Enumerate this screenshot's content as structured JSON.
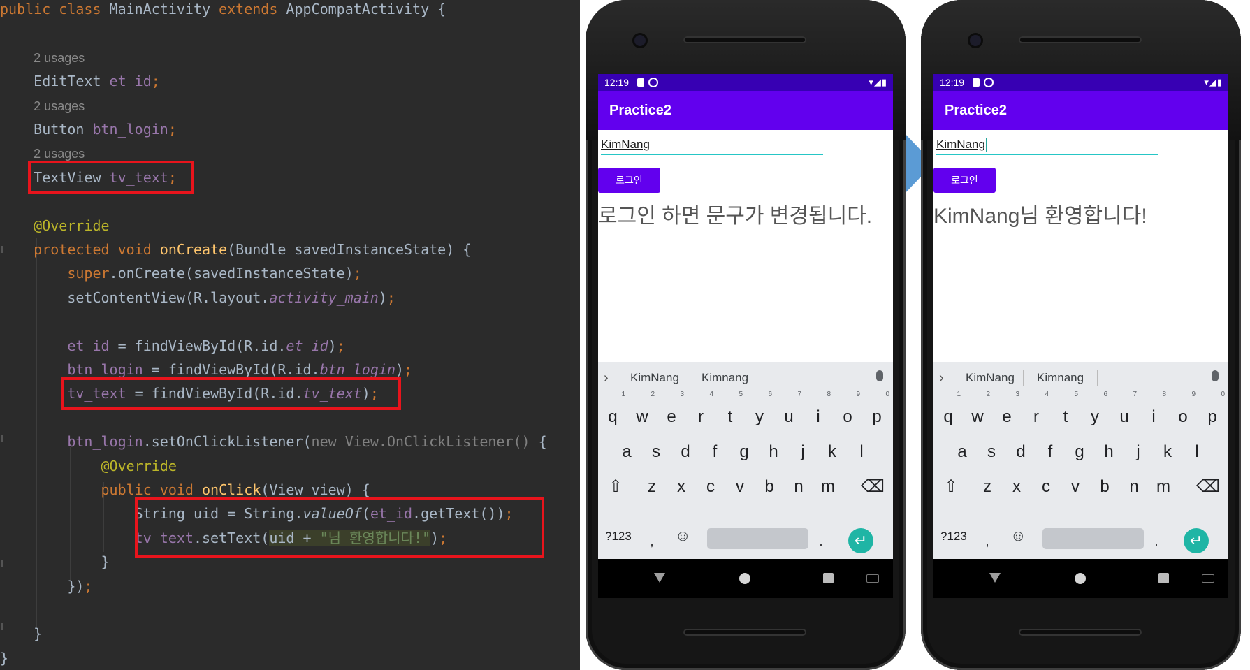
{
  "code_lines": [
    [
      {
        "t": "public",
        "c": "kw"
      },
      {
        "t": " "
      },
      {
        "t": "class",
        "c": "kw"
      },
      {
        "t": " MainActivity "
      },
      {
        "t": "extends",
        "c": "kw"
      },
      {
        "t": " AppCompatActivity {"
      }
    ],
    [],
    [
      {
        "t": "    "
      },
      {
        "t": "2 usages",
        "c": "usage"
      }
    ],
    [
      {
        "t": "    EditText "
      },
      {
        "t": "et_id",
        "c": "fld"
      },
      {
        "t": ";",
        "c": "kw"
      }
    ],
    [
      {
        "t": "    "
      },
      {
        "t": "2 usages",
        "c": "usage"
      }
    ],
    [
      {
        "t": "    Button "
      },
      {
        "t": "btn_login",
        "c": "fld"
      },
      {
        "t": ";",
        "c": "kw"
      }
    ],
    [
      {
        "t": "    "
      },
      {
        "t": "2 usages",
        "c": "usage"
      }
    ],
    [
      {
        "t": "    TextView "
      },
      {
        "t": "tv_text",
        "c": "fld"
      },
      {
        "t": ";",
        "c": "kw"
      }
    ],
    [],
    [
      {
        "t": "    "
      },
      {
        "t": "@Override",
        "c": "ann"
      }
    ],
    [
      {
        "t": "    "
      },
      {
        "t": "protected void",
        "c": "kw"
      },
      {
        "t": " "
      },
      {
        "t": "onCreate",
        "c": "fn"
      },
      {
        "t": "(Bundle savedInstanceState) {"
      }
    ],
    [
      {
        "t": "        "
      },
      {
        "t": "super",
        "c": "kw"
      },
      {
        "t": ".onCreate(savedInstanceState)"
      },
      {
        "t": ";",
        "c": "kw"
      }
    ],
    [
      {
        "t": "        setContentView(R.layout."
      },
      {
        "t": "activity_main",
        "c": "it"
      },
      {
        "t": ")"
      },
      {
        "t": ";",
        "c": "kw"
      }
    ],
    [],
    [
      {
        "t": "        "
      },
      {
        "t": "et_id",
        "c": "fld"
      },
      {
        "t": " = findViewById(R.id."
      },
      {
        "t": "et_id",
        "c": "it"
      },
      {
        "t": ")"
      },
      {
        "t": ";",
        "c": "kw"
      }
    ],
    [
      {
        "t": "        "
      },
      {
        "t": "btn_login",
        "c": "fld"
      },
      {
        "t": " = findViewById(R.id."
      },
      {
        "t": "btn_login",
        "c": "it"
      },
      {
        "t": ")"
      },
      {
        "t": ";",
        "c": "kw"
      }
    ],
    [
      {
        "t": "        "
      },
      {
        "t": "tv_text",
        "c": "fld"
      },
      {
        "t": " = findViewById(R.id."
      },
      {
        "t": "tv_text",
        "c": "it"
      },
      {
        "t": ")"
      },
      {
        "t": ";",
        "c": "kw"
      }
    ],
    [],
    [
      {
        "t": "        "
      },
      {
        "t": "btn_login",
        "c": "fld"
      },
      {
        "t": ".setOnClickListener("
      },
      {
        "t": "new View.OnClickListener()",
        "c": "dim"
      },
      {
        "t": " {"
      }
    ],
    [
      {
        "t": "            "
      },
      {
        "t": "@Override",
        "c": "ann"
      }
    ],
    [
      {
        "t": "            "
      },
      {
        "t": "public void",
        "c": "kw"
      },
      {
        "t": " "
      },
      {
        "t": "onClick",
        "c": "fn"
      },
      {
        "t": "(View view) {"
      }
    ],
    [
      {
        "t": "                String uid = String."
      },
      {
        "t": "valueOf",
        "c": "sit"
      },
      {
        "t": "("
      },
      {
        "t": "et_id",
        "c": "fld"
      },
      {
        "t": ".getText())"
      },
      {
        "t": ";",
        "c": "kw"
      }
    ],
    [
      {
        "t": "                "
      },
      {
        "t": "tv_text",
        "c": "fld"
      },
      {
        "t": ".setText("
      },
      {
        "t": "uid + ",
        "c": "hl"
      },
      {
        "t": "\"님 환영합니다!\"",
        "c": "str hl"
      },
      {
        "t": ")"
      },
      {
        "t": ";",
        "c": "kw"
      }
    ],
    [
      {
        "t": "            }"
      }
    ],
    [
      {
        "t": "        })"
      },
      {
        "t": ";",
        "c": "kw"
      }
    ],
    [],
    [
      {
        "t": "    }"
      }
    ],
    [
      {
        "t": "}"
      }
    ]
  ],
  "phones": [
    {
      "status_time": "12:19",
      "status_right": "▾◢▮",
      "app_title": "Practice2",
      "edit_text": "KimNang",
      "login_button": "로그인",
      "text_view": "로그인 하면 문구가 변경됩니다.",
      "suggestions": [
        "KimNang",
        "Kimnang"
      ],
      "cursor": false
    },
    {
      "status_time": "12:19",
      "status_right": "▾◢▮",
      "app_title": "Practice2",
      "edit_text": "KimNang",
      "login_button": "로그인",
      "text_view": "KimNang님 환영합니다!",
      "suggestions": [
        "KimNang",
        "Kimnang"
      ],
      "cursor": true
    }
  ],
  "keyboard": {
    "row1": [
      "q",
      "w",
      "e",
      "r",
      "t",
      "y",
      "u",
      "i",
      "o",
      "p"
    ],
    "row1_hints": [
      "1",
      "2",
      "3",
      "4",
      "5",
      "6",
      "7",
      "8",
      "9",
      "0"
    ],
    "row2": [
      "a",
      "s",
      "d",
      "f",
      "g",
      "h",
      "j",
      "k",
      "l"
    ],
    "row3": [
      "z",
      "x",
      "c",
      "v",
      "b",
      "n",
      "m"
    ],
    "shift": "⇧",
    "backspace": "⌫",
    "symbols": "?123",
    "comma": ",",
    "period": ".",
    "emoji": "☺",
    "enter": "↵",
    "chevron": "›"
  },
  "colors": {
    "editor_bg": "#2b2b2b",
    "highlight_box": "#e8141c",
    "status_bar": "#3700b3",
    "app_bar": "#6200ee",
    "arrow": "#5b9bd5"
  }
}
